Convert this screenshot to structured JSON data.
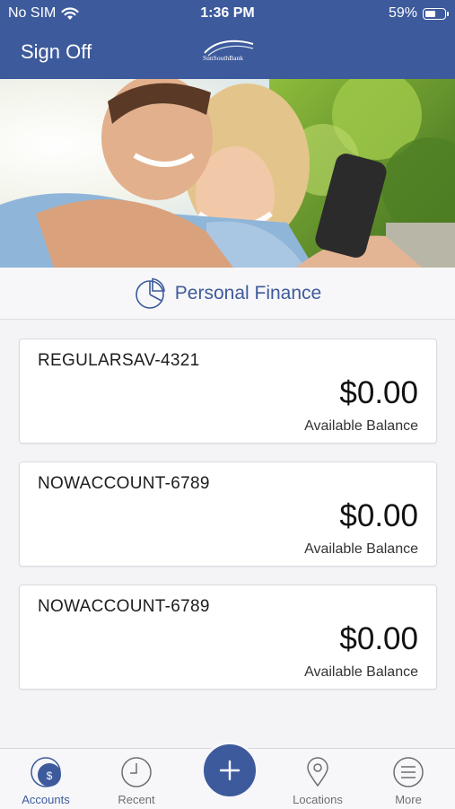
{
  "status_bar": {
    "carrier": "No SIM",
    "time": "1:36 PM",
    "battery": "59%",
    "battery_level": 0.59,
    "icons": [
      "wifi-icon",
      "battery-icon"
    ]
  },
  "nav": {
    "sign_off_label": "Sign Off",
    "logo_alt": "SunSouth Bank"
  },
  "hero": {
    "icon": "photo-couple-with-phone"
  },
  "section": {
    "title": "Personal Finance",
    "icon": "pie-chart-icon"
  },
  "accounts": [
    {
      "name": "REGULARSAV-4321",
      "balance": "$0.00",
      "caption": "Available Balance"
    },
    {
      "name": "NOWACCOUNT-6789",
      "balance": "$0.00",
      "caption": "Available Balance"
    },
    {
      "name": "NOWACCOUNT-6789",
      "balance": "$0.00",
      "caption": "Available Balance"
    }
  ],
  "tabs": [
    {
      "label": "Accounts",
      "icon": "accounts-icon",
      "active": true
    },
    {
      "label": "Recent",
      "icon": "clock-icon",
      "active": false
    },
    {
      "label": "Locations",
      "icon": "location-pin-icon",
      "active": false
    },
    {
      "label": "More",
      "icon": "menu-icon",
      "active": false
    }
  ],
  "add_button": {
    "icon": "plus-icon"
  },
  "colors": {
    "brand": "#3d5a9c",
    "background": "#f4f4f6",
    "card": "#ffffff",
    "tab_inactive": "#6e6e73"
  }
}
